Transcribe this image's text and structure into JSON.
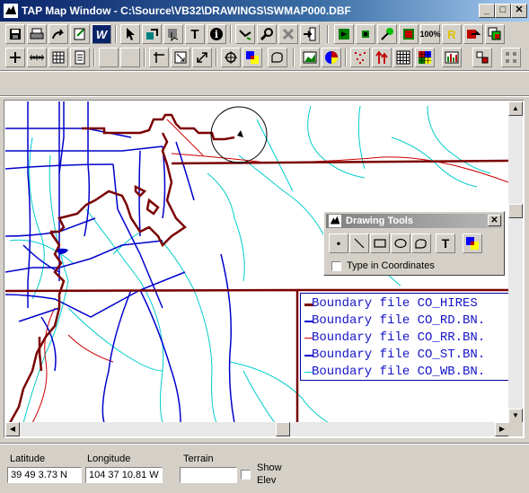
{
  "window": {
    "title": "TAP Map Window - C:\\Source\\VB32\\DRAWINGS\\SWMAP000.DBF",
    "minimize_label": "_",
    "maximize_label": "□",
    "close_label": "✕"
  },
  "toolbar_row1_icons": [
    "save-icon",
    "print-icon",
    "redo-icon",
    "edit-icon",
    "w-icon",
    "pointer-icon",
    "move-icon",
    "select-icon",
    "text-tool-icon",
    "info-icon",
    "route-icon",
    "zoom-tool-icon",
    "delete-icon",
    "exit-icon",
    "green-square-1-icon",
    "green-square-2-icon",
    "green-pin-icon",
    "red-square-icon",
    "zoom-100-icon",
    "yellow-r-icon",
    "red-tool-icon",
    "layers-icon"
  ],
  "toolbar_row2_icons": [
    "add-icon",
    "ruler-icon",
    "grid-icon",
    "notepad-icon",
    "blank-1-icon",
    "blank-2-icon",
    "axis-icon",
    "scale-icon",
    "resize-icon",
    "crosshair-icon",
    "color-squares-icon",
    "shape-icon",
    "area-chart-icon",
    "pie-chart-icon",
    "scatter-icon",
    "arrows-icon",
    "table-grid-icon",
    "color-grid-icon",
    "bar-chart-icon",
    "grid-settings-icon",
    "dots-grid-icon"
  ],
  "toolbar_labels": {
    "text_tool": "T",
    "info": "i",
    "zoom_100": "100%",
    "yellow_r": "R",
    "w": "W"
  },
  "legend": {
    "items": [
      {
        "label": "Boundary file CO_HIRES",
        "color": "#7a0000"
      },
      {
        "label": "Boundary file CO_RD.BN.",
        "color": "#0000cc"
      },
      {
        "label": "Boundary file CO_RR.BN.",
        "color": "#cc0000"
      },
      {
        "label": "Boundary file CO_ST.BN.",
        "color": "#0000cc"
      },
      {
        "label": "Boundary file CO_WB.BN.",
        "color": "#00cccc"
      }
    ]
  },
  "drawing_tools": {
    "title": "Drawing Tools",
    "close_label": "✕",
    "tools": [
      "point-tool-icon",
      "line-tool-icon",
      "rectangle-tool-icon",
      "ellipse-tool-icon",
      "polygon-tool-icon",
      "text-tool-icon",
      "fill-color-tool-icon"
    ],
    "text_tool_label": "T",
    "point_tool_label": "•",
    "type_coords_label": "Type in Coordinates",
    "type_coords_checked": false
  },
  "status": {
    "latitude_label": "Latitude",
    "latitude_value": "39 49 3.73 N",
    "longitude_label": "Longitude",
    "longitude_value": "104 37 10.81 W",
    "terrain_label": "Terrain",
    "terrain_value": "",
    "show_elev_label_1": "Show",
    "show_elev_label_2": "Elev",
    "show_elev_checked": false
  },
  "colors": {
    "boundary": "#7a0000",
    "roads": "#0000cc",
    "railroads": "#cc0000",
    "water": "#00cccc"
  }
}
